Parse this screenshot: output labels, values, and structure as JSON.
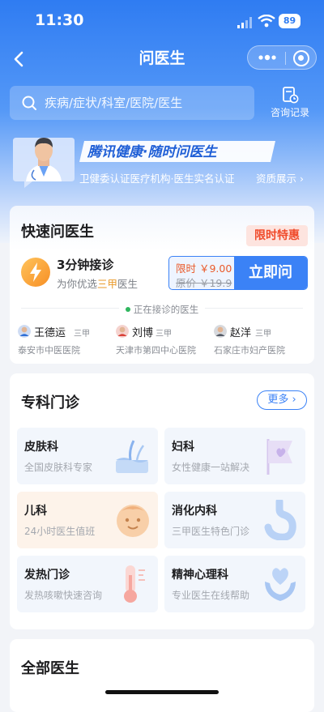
{
  "status_bar": {
    "time": "11:30",
    "battery": "89"
  },
  "nav": {
    "title": "问医生"
  },
  "search": {
    "placeholder": "疾病/症状/科室/医院/医生"
  },
  "history": {
    "label": "咨询记录"
  },
  "banner": {
    "slogan": "腾讯健康·随时问医生",
    "cert": "卫健委认证医疗机构·医生实名认证",
    "show_link": "资质展示 ›"
  },
  "quick": {
    "title": "快速问医生",
    "tag": "限时特惠",
    "main": "3分钟接诊",
    "sub_prefix": "为你优选",
    "sub_highlight": "三甲",
    "sub_suffix": "医生",
    "price_now": "限时 ￥9.00",
    "price_old": "原价 ￥19.9",
    "ask_button": "立即问",
    "online_label": "正在接诊的医生",
    "doctors": [
      {
        "name": "王德运",
        "level": "三甲",
        "hospital": "泰安市中医医院"
      },
      {
        "name": "刘博",
        "level": "三甲",
        "hospital": "天津市第四中心医院"
      },
      {
        "name": "赵洋",
        "level": "三甲",
        "hospital": "石家庄市妇产医院"
      }
    ]
  },
  "specialty": {
    "title": "专科门诊",
    "more": "更多 ›",
    "items": [
      {
        "name": "皮肤科",
        "desc": "全国皮肤科专家"
      },
      {
        "name": "妇科",
        "desc": "女性健康一站解决"
      },
      {
        "name": "儿科",
        "desc": "24小时医生值班"
      },
      {
        "name": "消化内科",
        "desc": "三甲医生特色门诊"
      },
      {
        "name": "发热门诊",
        "desc": "发热咳嗽快速咨询"
      },
      {
        "name": "精神心理科",
        "desc": "专业医生在线帮助"
      }
    ]
  },
  "all_doctors": {
    "title": "全部医生"
  },
  "colors": {
    "primary": "#3b82f6",
    "header": "#2f7cf2",
    "sale": "#f04a2a",
    "highlight": "#e99a2a"
  }
}
